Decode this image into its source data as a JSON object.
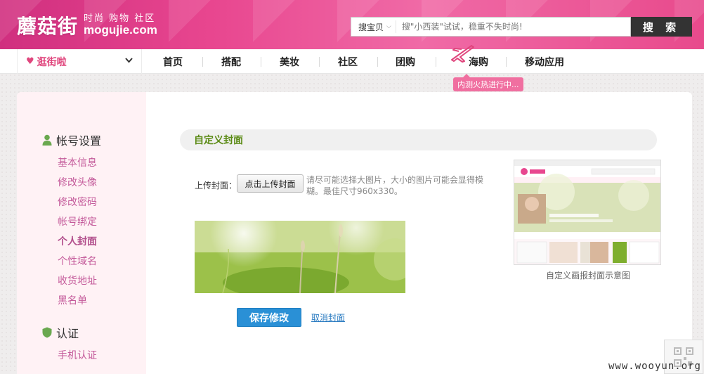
{
  "header": {
    "logo_text": "蘑菇街",
    "slogan": "时尚 购物 社区",
    "domain": "mogujie.com",
    "search": {
      "scope": "搜宝贝",
      "placeholder": "搜\"小西装\"试试，稳重不失时尚!",
      "button": "搜 索"
    }
  },
  "nav": {
    "shop_label": "逛街啦",
    "items": [
      "首页",
      "搭配",
      "美妆",
      "社区",
      "团购",
      "海购",
      "移动应用"
    ],
    "promo": "内测火热进行中..."
  },
  "sidebar": {
    "account_group": "帐号设置",
    "account_links": [
      "基本信息",
      "修改头像",
      "修改密码",
      "帐号绑定",
      "个人封面",
      "个性域名",
      "收货地址",
      "黑名单"
    ],
    "active_link": "个人封面",
    "verify_group": "认证",
    "verify_links": [
      "手机认证"
    ]
  },
  "main": {
    "section_title": "自定义封面",
    "upload_label": "上传封面：",
    "upload_button": "点击上传封面",
    "upload_hint": "请尽可能选择大图片，大小的图片可能会显得模糊。最佳尺寸960x330。",
    "save_button": "保存修改",
    "cancel_link": "取消封面",
    "preview_caption": "自定义画报封面示意图"
  },
  "watermark": "www.wooyun.org",
  "colors": {
    "brand_pink": "#e8468f",
    "sidebar_link": "#c45a9a",
    "section_title": "#5a8a14",
    "save_button": "#2a90d6"
  }
}
